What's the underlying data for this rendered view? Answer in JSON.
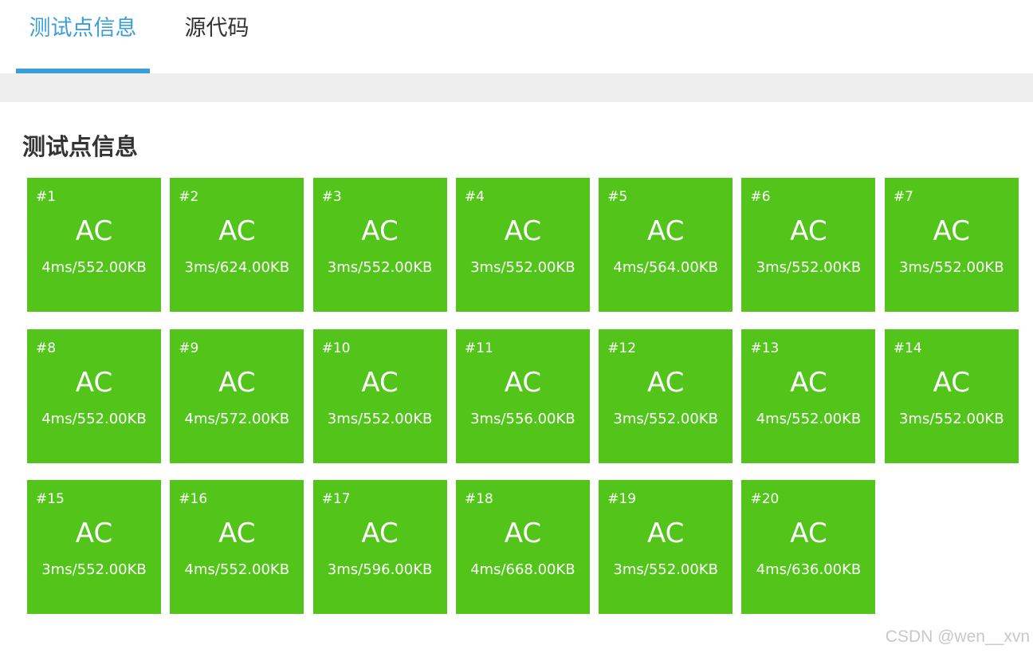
{
  "tabs": [
    {
      "label": "测试点信息",
      "active": true
    },
    {
      "label": "源代码",
      "active": false
    }
  ],
  "section": {
    "title": "测试点信息"
  },
  "colors": {
    "accent": "#3a9ed8",
    "ac_green": "#52c41a"
  },
  "cases": [
    {
      "num": "#1",
      "status": "AC",
      "detail": "4ms/552.00KB"
    },
    {
      "num": "#2",
      "status": "AC",
      "detail": "3ms/624.00KB"
    },
    {
      "num": "#3",
      "status": "AC",
      "detail": "3ms/552.00KB"
    },
    {
      "num": "#4",
      "status": "AC",
      "detail": "3ms/552.00KB"
    },
    {
      "num": "#5",
      "status": "AC",
      "detail": "4ms/564.00KB"
    },
    {
      "num": "#6",
      "status": "AC",
      "detail": "3ms/552.00KB"
    },
    {
      "num": "#7",
      "status": "AC",
      "detail": "3ms/552.00KB"
    },
    {
      "num": "#8",
      "status": "AC",
      "detail": "4ms/552.00KB"
    },
    {
      "num": "#9",
      "status": "AC",
      "detail": "4ms/572.00KB"
    },
    {
      "num": "#10",
      "status": "AC",
      "detail": "3ms/552.00KB"
    },
    {
      "num": "#11",
      "status": "AC",
      "detail": "3ms/556.00KB"
    },
    {
      "num": "#12",
      "status": "AC",
      "detail": "3ms/552.00KB"
    },
    {
      "num": "#13",
      "status": "AC",
      "detail": "4ms/552.00KB"
    },
    {
      "num": "#14",
      "status": "AC",
      "detail": "3ms/552.00KB"
    },
    {
      "num": "#15",
      "status": "AC",
      "detail": "3ms/552.00KB"
    },
    {
      "num": "#16",
      "status": "AC",
      "detail": "4ms/552.00KB"
    },
    {
      "num": "#17",
      "status": "AC",
      "detail": "3ms/596.00KB"
    },
    {
      "num": "#18",
      "status": "AC",
      "detail": "4ms/668.00KB"
    },
    {
      "num": "#19",
      "status": "AC",
      "detail": "3ms/552.00KB"
    },
    {
      "num": "#20",
      "status": "AC",
      "detail": "4ms/636.00KB"
    }
  ],
  "watermark": "CSDN @wen__xvn"
}
